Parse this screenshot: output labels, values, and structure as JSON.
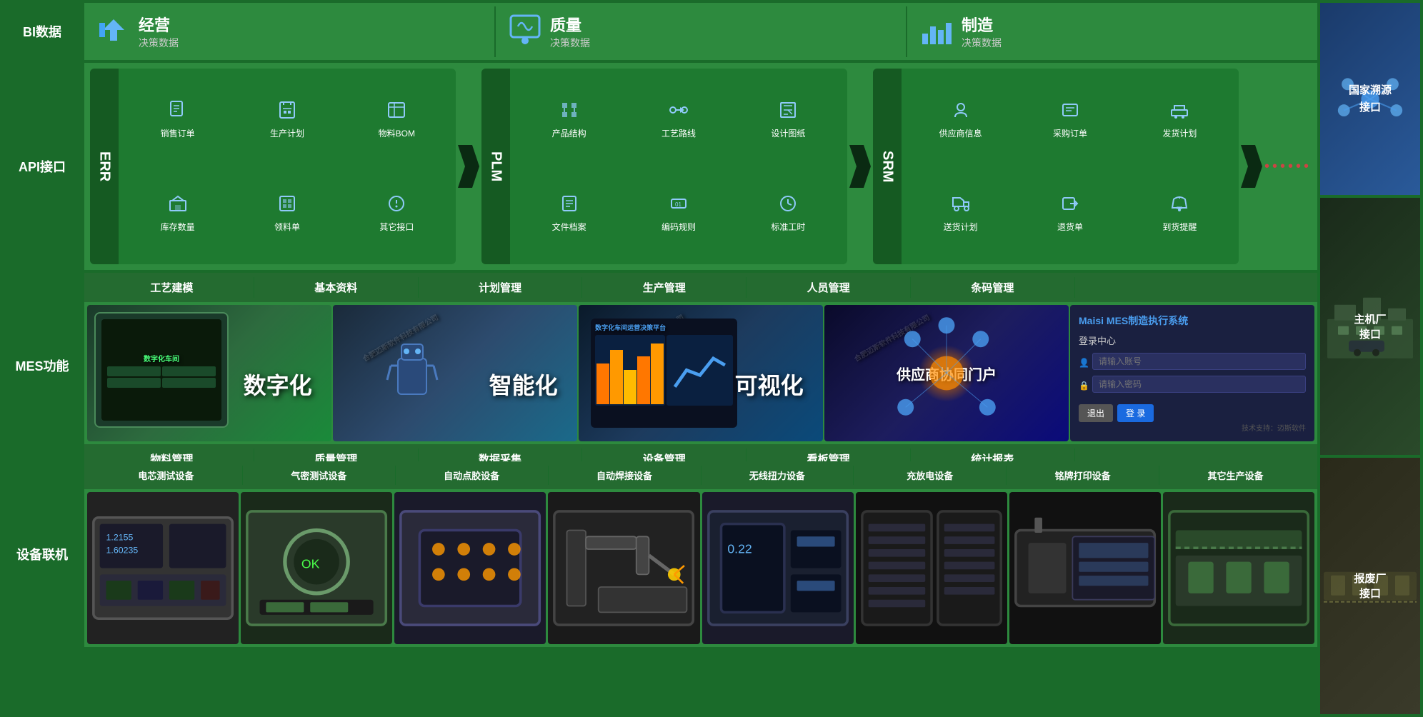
{
  "header": {
    "bi_label": "BI数据",
    "sections": [
      {
        "icon": "📊",
        "title": "经营",
        "subtitle": "决策数据"
      },
      {
        "icon": "📈",
        "title": "质量",
        "subtitle": "决策数据"
      },
      {
        "icon": "🏭",
        "title": "制造",
        "subtitle": "决策数据"
      }
    ]
  },
  "api": {
    "label": "API接口",
    "systems": [
      {
        "name": "ERR",
        "items": [
          {
            "label": "销售订单",
            "icon": "📋"
          },
          {
            "label": "生产计划",
            "icon": "📅"
          },
          {
            "label": "物料BOM",
            "icon": "📄"
          },
          {
            "label": "库存数量",
            "icon": "🏪"
          },
          {
            "label": "领料单",
            "icon": "📦"
          },
          {
            "label": "其它接口",
            "icon": "🔗"
          }
        ]
      },
      {
        "name": "PLM",
        "items": [
          {
            "label": "产品结构",
            "icon": "🔧"
          },
          {
            "label": "工艺路线",
            "icon": "🛤️"
          },
          {
            "label": "设计图纸",
            "icon": "📐"
          },
          {
            "label": "文件档案",
            "icon": "📁"
          },
          {
            "label": "编码规则",
            "icon": "🔢"
          },
          {
            "label": "标准工时",
            "icon": "⏱️"
          }
        ]
      },
      {
        "name": "SRM",
        "items": [
          {
            "label": "供应商信息",
            "icon": "🏢"
          },
          {
            "label": "采购订单",
            "icon": "🛒"
          },
          {
            "label": "发货计划",
            "icon": "🚚"
          },
          {
            "label": "送货计划",
            "icon": "📬"
          },
          {
            "label": "退货单",
            "icon": "↩️"
          },
          {
            "label": "到货提醒",
            "icon": "🔔"
          }
        ]
      }
    ]
  },
  "mes": {
    "label": "MES功能",
    "top_functions": [
      "工艺建模",
      "基本资料",
      "计划管理",
      "生产管理",
      "人员管理",
      "条码管理"
    ],
    "bottom_functions": [
      "物料管理",
      "质量管理",
      "数据采集",
      "设备管理",
      "看板管理",
      "统计报表"
    ],
    "features": [
      {
        "label": "数字化",
        "type": "digital"
      },
      {
        "label": "智能化",
        "type": "smart"
      },
      {
        "label": "可视化",
        "type": "visual"
      },
      {
        "label": "供应商协同门户",
        "type": "supplier"
      }
    ]
  },
  "equipment": {
    "label": "设备联机",
    "items": [
      "电芯测试设备",
      "气密测试设备",
      "自动点胶设备",
      "自动焊接设备",
      "无线扭力设备",
      "充放电设备",
      "铭牌打印设备",
      "其它生产设备"
    ]
  },
  "right_panels": [
    {
      "label": "国家溯源\n接口"
    },
    {
      "label": "主机厂\n接口"
    },
    {
      "label": "报废厂\n接口"
    }
  ],
  "watermark": "合肥迈斯软件科技有限公司",
  "company": "合肥迈斯软件科技有限公司",
  "mes_brand": "Maisi MES制造执行系统",
  "login": {
    "title": "登录中心",
    "user_placeholder": "请输入账号",
    "pwd_placeholder": "请输入密码",
    "logout_btn": "退出",
    "login_btn": "登 录",
    "footer": "技术支持：迈斯软件"
  }
}
